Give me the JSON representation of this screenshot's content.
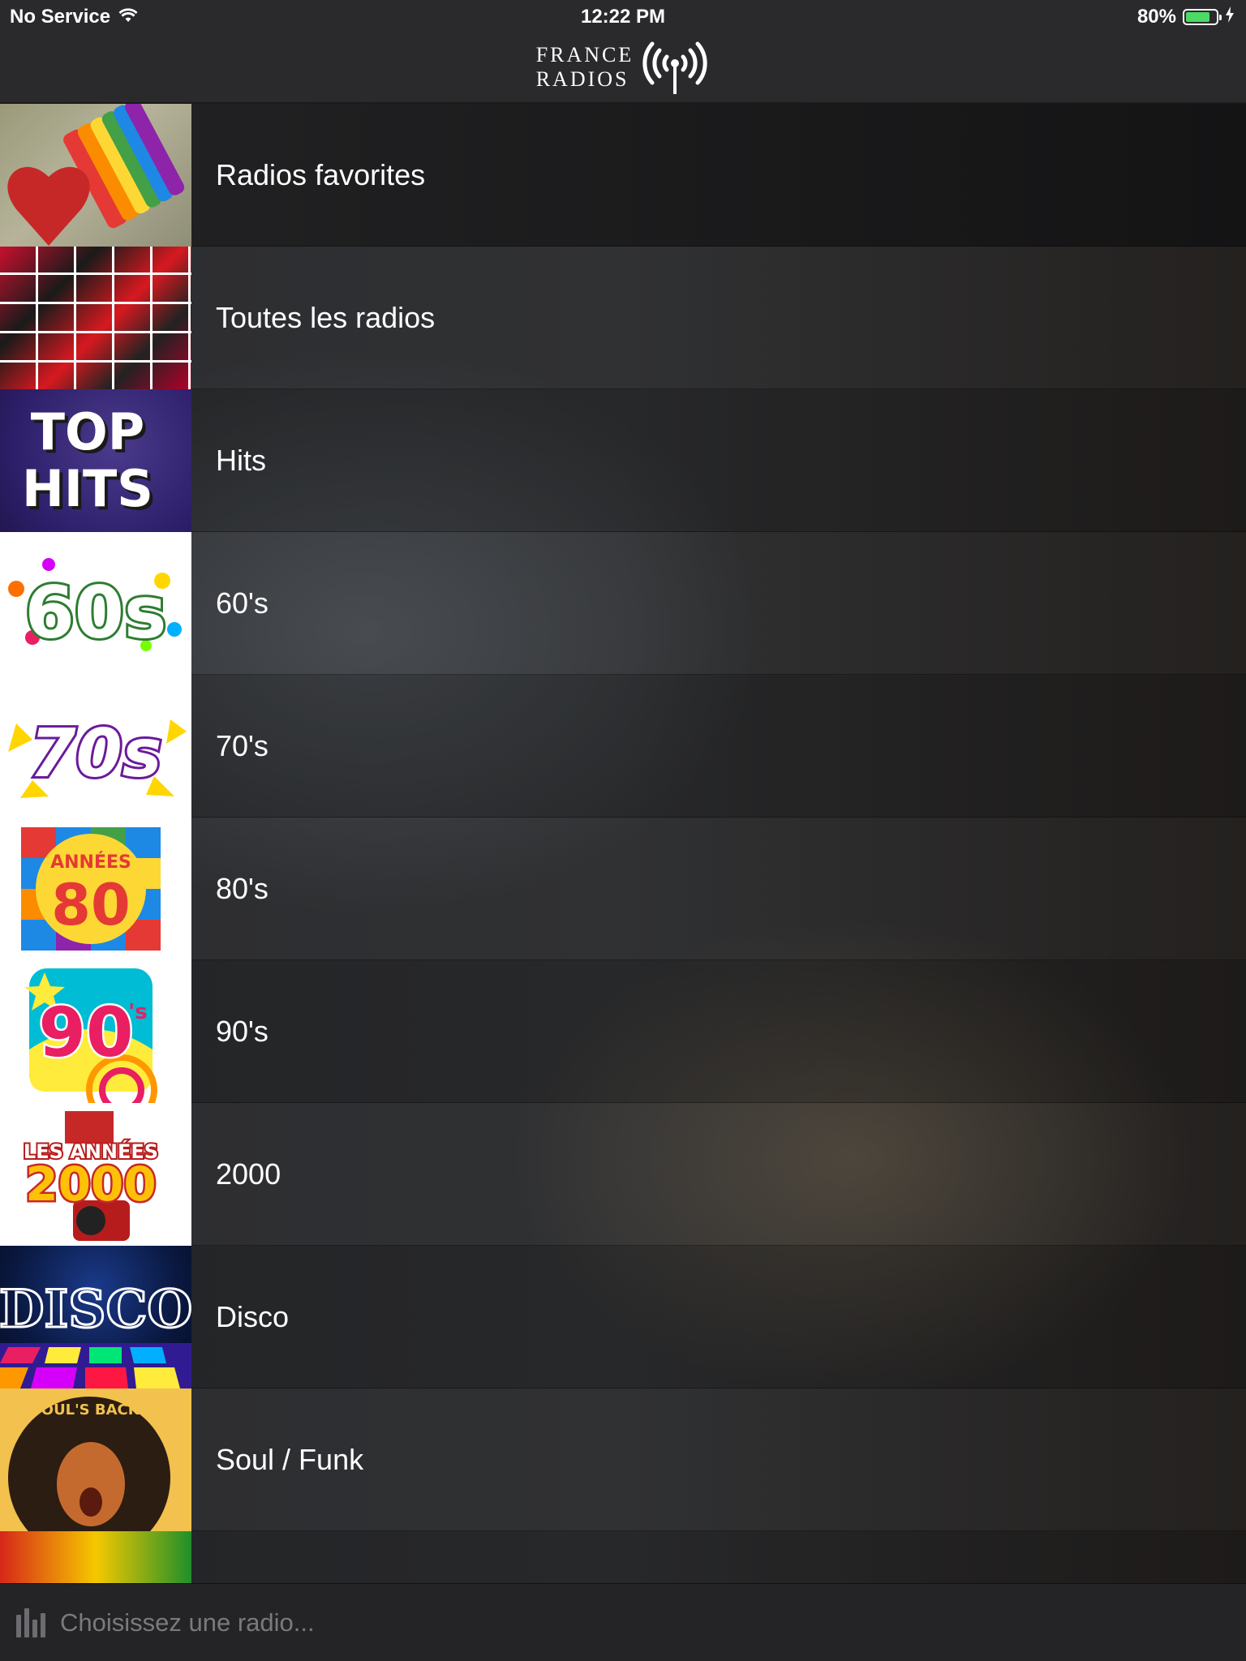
{
  "status_bar": {
    "carrier": "No Service",
    "time": "12:22 PM",
    "battery_percent": "80%",
    "battery_level": 0.8,
    "battery_color": "#4cd964",
    "wifi_icon": "wifi-icon",
    "charging_icon": "lightning-icon"
  },
  "nav": {
    "logo_line1": "FRANCE",
    "logo_line2": "RADIOS",
    "logo_icon": "radio-antenna-icon"
  },
  "categories": [
    {
      "label": "Radios favorites",
      "thumb": "heart-rainbow"
    },
    {
      "label": "Toutes les radios",
      "thumb": "radio-logos-collage"
    },
    {
      "label": "Hits",
      "thumb": "top-hits",
      "thumb_text_1": "TOP",
      "thumb_text_2": "HITS"
    },
    {
      "label": "60's",
      "thumb": "60s-flowers",
      "thumb_text": "60s"
    },
    {
      "label": "70's",
      "thumb": "70s-star",
      "thumb_text": "70s"
    },
    {
      "label": "80's",
      "thumb": "annees-80",
      "thumb_text_1": "ANNÉES",
      "thumb_text_2": "80"
    },
    {
      "label": "90's",
      "thumb": "90s",
      "thumb_text": "90",
      "thumb_text_2": "'s"
    },
    {
      "label": "2000",
      "thumb": "les-annees-2000",
      "thumb_text_1": "LES ANNÉES",
      "thumb_text_2": "2000"
    },
    {
      "label": "Disco",
      "thumb": "disco",
      "thumb_text": "DISCO"
    },
    {
      "label": "Soul / Funk",
      "thumb": "soul-afro",
      "thumb_text": "SOUL'S BACK !"
    },
    {
      "label": "",
      "thumb": "reggae-partial"
    }
  ],
  "player": {
    "placeholder": "Choisissez une radio...",
    "icon": "equalizer-icon"
  }
}
